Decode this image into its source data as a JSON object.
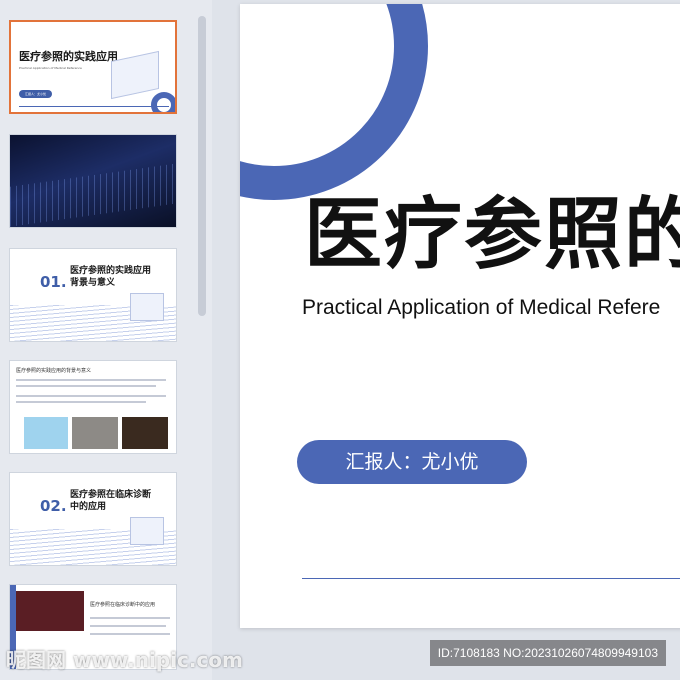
{
  "thumbnails": [
    {
      "title": "医疗参照的实践应用",
      "subtitle": "Practical Application of Medical Reference",
      "pill": "汇报人：尤小优",
      "selected": true
    },
    {
      "title": "",
      "subtitle": "",
      "image": "dark-tech-background"
    },
    {
      "number": "01.",
      "title": "医疗参照的实践应用",
      "title2": "背景与意义"
    },
    {
      "title": "医疗参照的实践应用的背景与意义"
    },
    {
      "number": "02.",
      "title": "医疗参照在临床诊断",
      "title2": "中的应用"
    },
    {
      "title": "医疗参照在临床诊断中的应用"
    }
  ],
  "slide": {
    "title": "医疗参照的",
    "subtitle": "Practical Application of Medical Refere",
    "presenter": "汇报人：尤小优"
  },
  "watermark": {
    "logo": "昵图网 www.nipic.com",
    "id": "ID:7108183 NO:20231026074809949103"
  },
  "colors": {
    "accent": "#4b67b5",
    "selection": "#e2733a"
  }
}
